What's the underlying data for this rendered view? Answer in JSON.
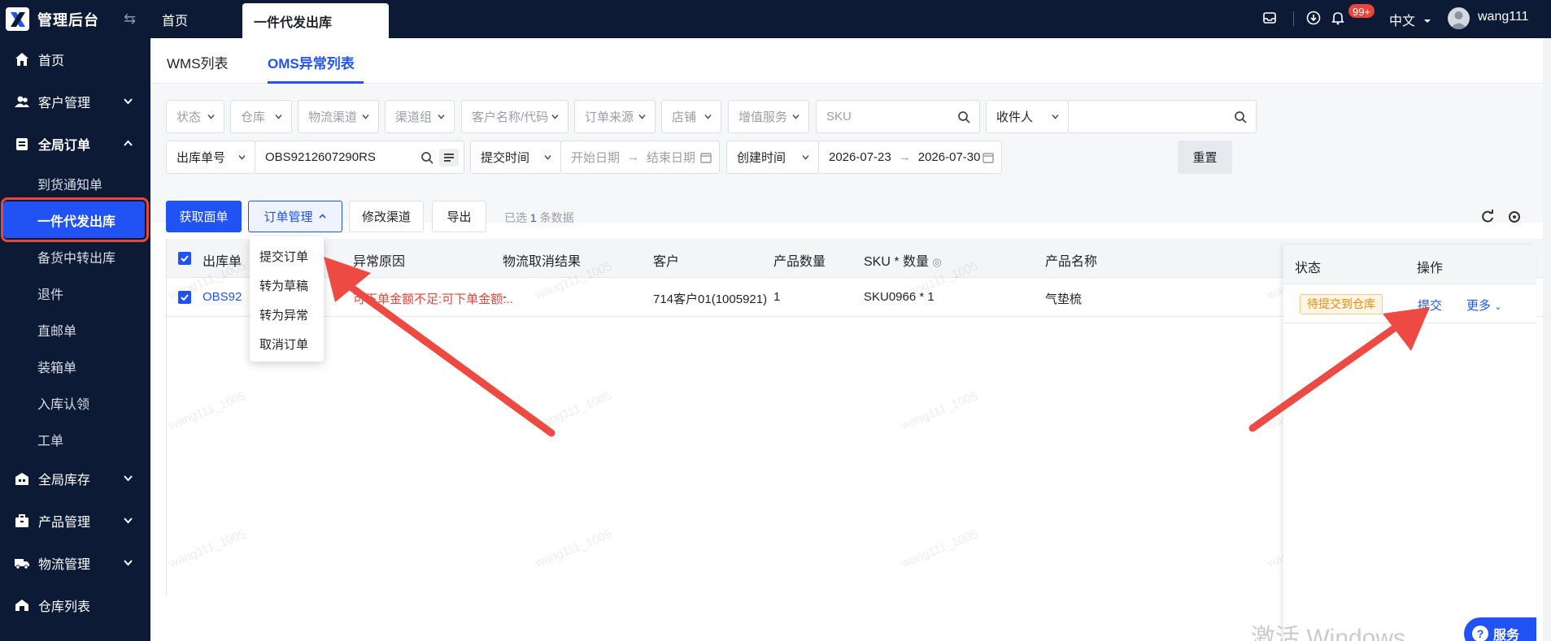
{
  "brand": {
    "title": "管理后台"
  },
  "sidebar": {
    "items": [
      {
        "label": "首页",
        "icon": "home-icon"
      },
      {
        "label": "客户管理",
        "icon": "users-icon"
      },
      {
        "label": "全局订单",
        "icon": "clipboard-icon"
      }
    ],
    "sub_items": [
      {
        "label": "到货通知单"
      },
      {
        "label": "一件代发出库"
      },
      {
        "label": "备货中转出库"
      },
      {
        "label": "退件"
      },
      {
        "label": "直邮单"
      },
      {
        "label": "装箱单"
      },
      {
        "label": "入库认领"
      },
      {
        "label": "工单"
      }
    ],
    "bottom_items": [
      {
        "label": "全局库存",
        "icon": "warehouse-icon"
      },
      {
        "label": "产品管理",
        "icon": "box-icon"
      },
      {
        "label": "物流管理",
        "icon": "truck-icon"
      },
      {
        "label": "仓库列表",
        "icon": "building-icon"
      }
    ]
  },
  "topbar": {
    "tabs": [
      {
        "label": "首页"
      },
      {
        "label": "一件代发出库"
      }
    ],
    "badge": "99+",
    "language": "中文",
    "username": "wang111"
  },
  "subtabs": [
    {
      "label": "WMS列表"
    },
    {
      "label": "OMS异常列表"
    }
  ],
  "filters": {
    "row1": [
      "状态",
      "仓库",
      "物流渠道",
      "渠道组",
      "客户名称/代码",
      "订单来源",
      "店铺",
      "增值服务"
    ],
    "sku_placeholder": "SKU",
    "receiver_label": "收件人",
    "order_no_label": "出库单号",
    "order_no_value": "OBS9212607290RS",
    "submit_time_label": "提交时间",
    "start_placeholder": "开始日期",
    "end_placeholder": "结束日期",
    "create_time_label": "创建时间",
    "create_start": "2026-07-23",
    "create_end": "2026-07-30",
    "reset_label": "重置"
  },
  "toolbar": {
    "get_label": "获取面单",
    "order_mgmt_label": "订单管理",
    "channel_label": "修改渠道",
    "export_label": "导出",
    "selected_prefix": "已选",
    "selected_count": "1",
    "selected_suffix": "条数据"
  },
  "dropdown": {
    "items": [
      {
        "label": "提交订单"
      },
      {
        "label": "转为草稿"
      },
      {
        "label": "转为异常"
      },
      {
        "label": "取消订单"
      }
    ]
  },
  "table": {
    "columns": [
      "出库单",
      "异常原因",
      "物流取消结果",
      "客户",
      "产品数量",
      "SKU * 数量",
      "产品名称",
      "状态",
      "操作"
    ],
    "row": {
      "order_no": "OBS92",
      "reason": "可下单金额不足:可下单金额...",
      "cancel_result": "-",
      "customer": "714客户01(1005921)",
      "qty": "1",
      "sku_qty": "SKU0966 * 1",
      "product": "气垫梳",
      "status": "待提交到仓库",
      "action_submit": "提交",
      "action_more": "更多"
    }
  },
  "watermark": "wang111_1005",
  "activate_text": "激活 Windows",
  "service_label": "服务",
  "colors": {
    "primary": "#2153f4",
    "sidebar": "#0c1a35",
    "danger": "#e8453c",
    "warning": "#f08c00"
  }
}
